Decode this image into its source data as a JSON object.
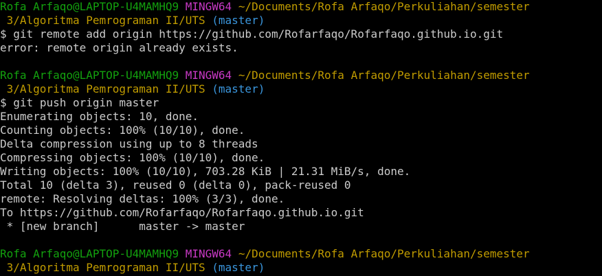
{
  "colors": {
    "background": "#000000",
    "user_host": "#13a10e",
    "msystem": "#c839c5",
    "path": "#c19c00",
    "branch": "#3a96dd",
    "text": "#cccccc"
  },
  "prompt": {
    "user_host": "Rofa Arfaqo@LAPTOP-U4MAMHQ9",
    "msystem": "MINGW64",
    "path_line1": "~/Documents/Rofa Arfaqo/Perkuliahan/semester",
    "path_line2": " 3/Algoritma Pemrograman II/UTS",
    "branch": "(master)",
    "symbol": "$"
  },
  "blocks": [
    {
      "command": "git remote add origin https://github.com/Rofarfaqo/Rofarfaqo.github.io.git",
      "output": [
        "error: remote origin already exists."
      ]
    },
    {
      "command": "git push origin master",
      "output": [
        "Enumerating objects: 10, done.",
        "Counting objects: 100% (10/10), done.",
        "Delta compression using up to 8 threads",
        "Compressing objects: 100% (10/10), done.",
        "Writing objects: 100% (10/10), 703.28 KiB | 21.31 MiB/s, done.",
        "Total 10 (delta 3), reused 0 (delta 0), pack-reused 0",
        "remote: Resolving deltas: 100% (3/3), done.",
        "To https://github.com/Rofarfaqo/Rofarfaqo.github.io.git",
        " * [new branch]      master -> master"
      ]
    }
  ]
}
